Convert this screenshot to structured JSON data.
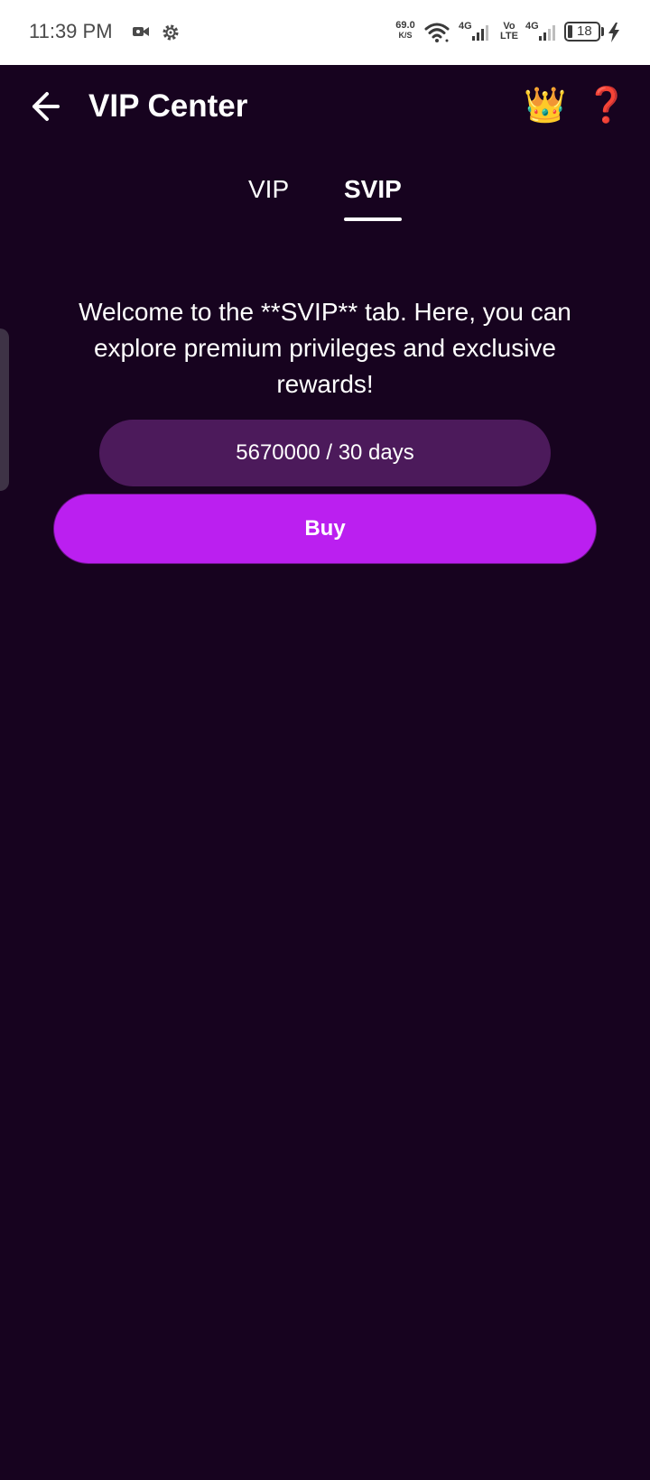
{
  "status_bar": {
    "time": "11:39 PM",
    "net_speed_value": "69.0",
    "net_speed_unit": "K/S",
    "signal_1_label": "4G",
    "volte_top": "Vo",
    "volte_bottom": "LTE",
    "signal_2_label": "4G",
    "battery_level": "18"
  },
  "header": {
    "title": "VIP Center",
    "crown_icon": "👑",
    "help_icon": "❓"
  },
  "tabs": [
    {
      "label": "VIP",
      "selected": false
    },
    {
      "label": "SVIP",
      "selected": true
    }
  ],
  "content": {
    "welcome_text": "Welcome to the **SVIP** tab. Here, you can explore premium privileges and exclusive rewards!",
    "price_text": "5670000 / 30 days",
    "buy_label": "Buy"
  },
  "colors": {
    "background": "#17031f",
    "price_pill": "#4c1a5b",
    "buy_button": "#bb1ff0"
  }
}
